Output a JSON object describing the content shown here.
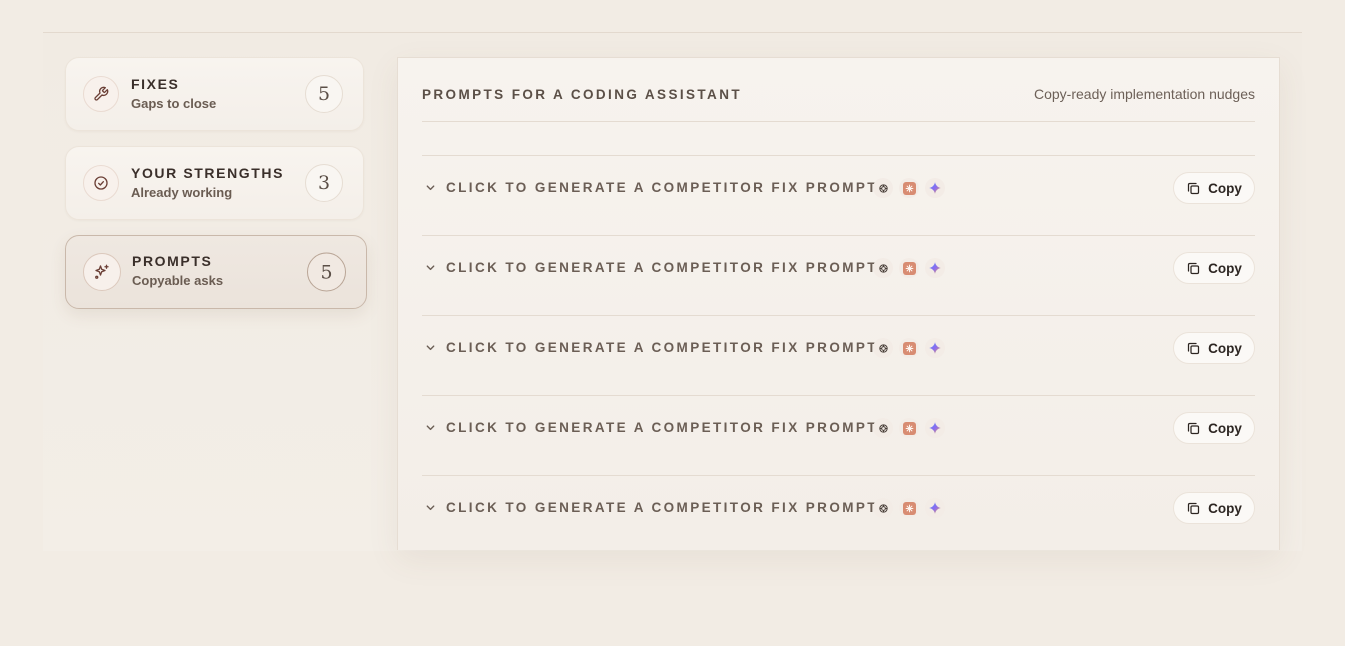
{
  "sidebar": {
    "items": [
      {
        "title": "FIXES",
        "subtitle": "Gaps to close",
        "count": "5",
        "icon": "wrench-icon",
        "active": false
      },
      {
        "title": "YOUR STRENGTHS",
        "subtitle": "Already working",
        "count": "3",
        "icon": "check-circle-icon",
        "active": false
      },
      {
        "title": "PROMPTS",
        "subtitle": "Copyable asks",
        "count": "5",
        "icon": "sparkles-icon",
        "active": true
      }
    ]
  },
  "panel": {
    "title": "PROMPTS FOR A CODING ASSISTANT",
    "subtitle": "Copy-ready implementation nudges",
    "prompts": [
      {
        "label": "CLICK TO GENERATE A COMPETITOR FIX PROMPT.",
        "copy_label": "Copy"
      },
      {
        "label": "CLICK TO GENERATE A COMPETITOR FIX PROMPT.",
        "copy_label": "Copy"
      },
      {
        "label": "CLICK TO GENERATE A COMPETITOR FIX PROMPT.",
        "copy_label": "Copy"
      },
      {
        "label": "CLICK TO GENERATE A COMPETITOR FIX PROMPT.",
        "copy_label": "Copy"
      },
      {
        "label": "CLICK TO GENERATE A COMPETITOR FIX PROMPT.",
        "copy_label": "Copy"
      }
    ],
    "ai_icons": [
      "chatgpt-icon",
      "claude-icon",
      "gemini-icon"
    ]
  },
  "colors": {
    "background": "#f2ece4",
    "accent_claude": "#d88c72",
    "text_dark": "#3a2f2a",
    "text_muted": "#6b5e55"
  }
}
